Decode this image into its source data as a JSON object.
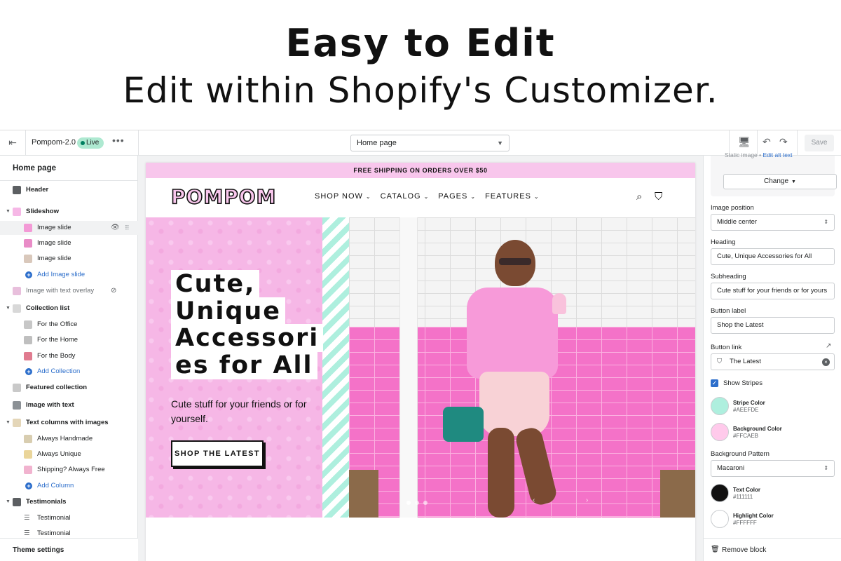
{
  "banner": {
    "headline": "Easy to Edit",
    "subline": "Edit within Shopify's Customizer."
  },
  "topbar": {
    "theme_name": "Pompom-2.0",
    "live_badge": "Live",
    "page_select": "Home page",
    "save_label": "Save"
  },
  "left_sidebar": {
    "title": "Home page",
    "items": [
      {
        "label": "Header"
      },
      {
        "label": "Slideshow"
      },
      {
        "label": "Image slide"
      },
      {
        "label": "Image slide"
      },
      {
        "label": "Image slide"
      },
      {
        "label": "Add Image slide"
      },
      {
        "label": "Image with text overlay"
      },
      {
        "label": "Collection list"
      },
      {
        "label": "For the Office"
      },
      {
        "label": "For the Home"
      },
      {
        "label": "For the Body"
      },
      {
        "label": "Add Collection"
      },
      {
        "label": "Featured collection"
      },
      {
        "label": "Image with text"
      },
      {
        "label": "Text columns with images"
      },
      {
        "label": "Always Handmade"
      },
      {
        "label": "Always Unique"
      },
      {
        "label": "Shipping? Always Free"
      },
      {
        "label": "Add Column"
      },
      {
        "label": "Testimonials"
      },
      {
        "label": "Testimonial"
      },
      {
        "label": "Testimonial"
      }
    ],
    "theme_settings": "Theme settings"
  },
  "preview": {
    "shipping_bar": "FREE SHIPPING ON ORDERS OVER $50",
    "logo": "POMPOM",
    "nav": [
      "SHOP NOW",
      "CATALOG",
      "PAGES",
      "FEATURES"
    ],
    "hero_heading_lines": [
      "Cute,",
      "Unique",
      "Accessori",
      "es for All"
    ],
    "hero_subheading": "Cute stuff for your friends or for yourself.",
    "hero_button": "SHOP THE LATEST",
    "colors": {
      "shipping_bar": "#F8C6EC",
      "stripe": "#AEEFDE",
      "hero_pink": "#F6B7E6"
    }
  },
  "right_sidebar": {
    "image_meta": "Static image",
    "image_meta_link": "Edit alt text",
    "change_button": "Change",
    "image_position_label": "Image position",
    "image_position_value": "Middle center",
    "heading_label": "Heading",
    "heading_value": "Cute, Unique Accessories for All",
    "subheading_label": "Subheading",
    "subheading_value": "Cute stuff for your friends or for yours",
    "button_label_label": "Button label",
    "button_label_value": "Shop the Latest",
    "button_link_label": "Button link",
    "button_link_value": "The Latest",
    "show_stripes_label": "Show Stripes",
    "show_stripes_checked": true,
    "stripe_color_name": "Stripe Color",
    "stripe_color_hex": "#AEEFDE",
    "background_color_name": "Background Color",
    "background_color_hex": "#FFCAEB",
    "background_pattern_label": "Background Pattern",
    "background_pattern_value": "Macaroni",
    "text_color_name": "Text Color",
    "text_color_hex": "#111111",
    "highlight_color_name": "Highlight Color",
    "highlight_color_hex": "#FFFFFF",
    "remove_block": "Remove block"
  }
}
